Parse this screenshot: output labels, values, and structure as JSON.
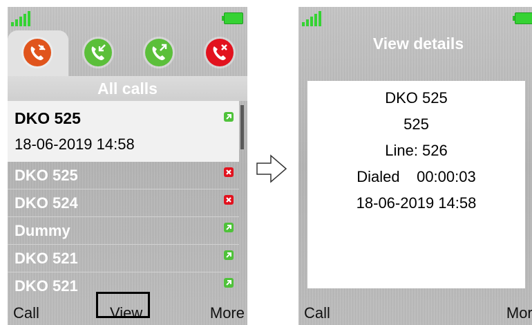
{
  "left_screen": {
    "tabs": [
      {
        "icon": "all-calls-icon",
        "color": "#e0541c"
      },
      {
        "icon": "received-calls-icon",
        "color": "#5bbf3a"
      },
      {
        "icon": "dialed-calls-icon",
        "color": "#5bbf3a"
      },
      {
        "icon": "missed-calls-icon",
        "color": "#e2121e"
      }
    ],
    "section_title": "All calls",
    "selected": {
      "name": "DKO 525",
      "time": "18-06-2019 14:58",
      "badge": "dialed-icon"
    },
    "rows": [
      {
        "name": "DKO 525",
        "badge": "missed-icon"
      },
      {
        "name": "DKO 524",
        "badge": "missed-icon"
      },
      {
        "name": "Dummy",
        "badge": "dialed-icon"
      },
      {
        "name": "DKO 521",
        "badge": "dialed-icon"
      },
      {
        "name": "DKO 521",
        "badge": "dialed-icon"
      }
    ],
    "softkeys": {
      "left": "Call",
      "middle": "View",
      "right": "More"
    }
  },
  "right_screen": {
    "title": "View details",
    "lines": [
      "DKO 525",
      "525",
      "Line: 526",
      "Dialed    00:00:03",
      "18-06-2019 14:58"
    ],
    "softkeys": {
      "left": "Call",
      "right": "More"
    }
  },
  "colors": {
    "battery": "#35d233",
    "signal": "#35d233",
    "dialed_badge": "#4fc23a",
    "missed_badge": "#e2121e"
  }
}
